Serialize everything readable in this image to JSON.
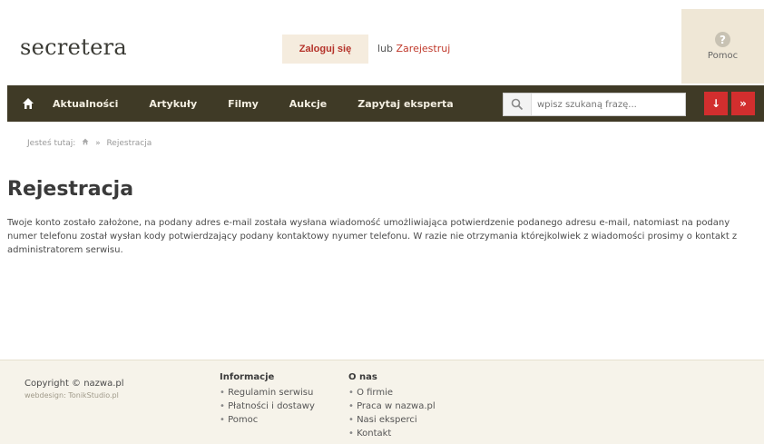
{
  "header": {
    "logo": "secretera",
    "login_label": "Zaloguj się",
    "or_text": "lub",
    "register_label": "Zarejestruj",
    "help_label": "Pomoc",
    "help_icon_glyph": "?"
  },
  "nav": {
    "items": [
      {
        "label": "Aktualności"
      },
      {
        "label": "Artykuły"
      },
      {
        "label": "Filmy"
      },
      {
        "label": "Aukcje"
      },
      {
        "label": "Zapytaj eksperta"
      }
    ],
    "search_placeholder": "wpisz szukaną frazę...",
    "btn1_glyph": "↓",
    "btn2_glyph": "»",
    "accent_color": "#d22e2e",
    "bar_color": "#3f3a26"
  },
  "breadcrumb": {
    "prefix": "Jesteś tutaj:",
    "separator": "»",
    "current": "Rejestracja"
  },
  "main": {
    "title": "Rejestracja",
    "message": "Twoje konto zostało założone, na podany adres e-mail została wysłana wiadomość umożliwiająca potwierdzenie podanego adresu e-mail, natomiast na podany numer telefonu został wysłan kody potwierdzający podany kontaktowy nyumer telefonu. W razie nie otrzymania którejkolwiek z wiadomości prosimy o kontakt z administratorem serwisu."
  },
  "footer": {
    "copyright": "Copyright © nazwa.pl",
    "webdesign": "webdesign: TonikStudio.pl",
    "columns": [
      {
        "title": "Informacje",
        "links": [
          "Regulamin serwisu",
          "Płatności i dostawy",
          "Pomoc"
        ]
      },
      {
        "title": "O nas",
        "links": [
          "O firmie",
          "Praca w nazwa.pl",
          "Nasi eksperci",
          "Kontakt"
        ]
      }
    ]
  }
}
